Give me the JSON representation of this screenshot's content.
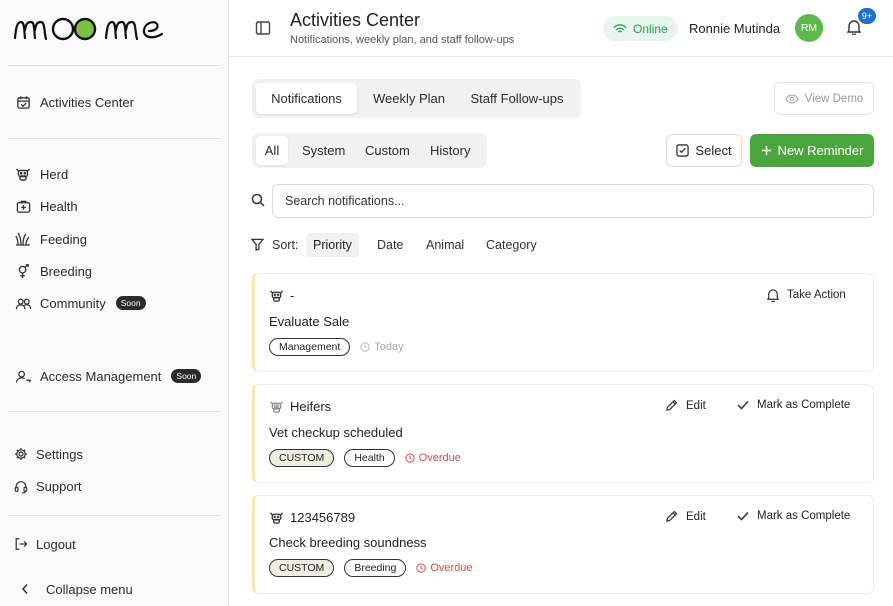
{
  "app": {
    "logo_text": "moome"
  },
  "sidebar": {
    "items": [
      {
        "label": "Activities Center",
        "icon": "calendar-check-icon"
      },
      {
        "label": "Herd",
        "icon": "cow-icon"
      },
      {
        "label": "Health",
        "icon": "medical-kit-icon"
      },
      {
        "label": "Feeding",
        "icon": "grass-icon"
      },
      {
        "label": "Breeding",
        "icon": "gender-icon"
      },
      {
        "label": "Community",
        "icon": "users-icon",
        "badge": "Soon"
      },
      {
        "label": "Access Management",
        "icon": "user-key-icon",
        "badge": "Soon"
      },
      {
        "label": "Settings",
        "icon": "gear-icon"
      },
      {
        "label": "Support",
        "icon": "headset-icon"
      },
      {
        "label": "Logout",
        "icon": "logout-icon"
      }
    ],
    "collapse_label": "Collapse menu"
  },
  "header": {
    "title": "Activities Center",
    "subtitle": "Notifications, weekly plan, and staff follow-ups",
    "status": "Online",
    "user_name": "Ronnie Mutinda",
    "avatar_initials": "RM",
    "notification_badge": "9+"
  },
  "tabs": [
    "Notifications",
    "Weekly Plan",
    "Staff Follow-ups"
  ],
  "view_demo_label": "View Demo",
  "filters": [
    "All",
    "System",
    "Custom",
    "History"
  ],
  "select_label": "Select",
  "new_reminder_label": "New Reminder",
  "search": {
    "placeholder": "Search notifications..."
  },
  "sort": {
    "label": "Sort:",
    "options": [
      "Priority",
      "Date",
      "Animal",
      "Category"
    ],
    "active": "Priority"
  },
  "notifications": [
    {
      "animal": "-",
      "title": "Evaluate Sale",
      "tags": [
        "Management"
      ],
      "when": "Today",
      "actions": [
        "Take Action"
      ]
    },
    {
      "animal": "Heifers",
      "title": "Vet checkup scheduled",
      "tags": [
        "CUSTOM",
        "Health"
      ],
      "when": "Overdue",
      "actions": [
        "Edit",
        "Mark as Complete"
      ]
    },
    {
      "animal": "123456789",
      "title": "Check breeding soundness",
      "tags": [
        "CUSTOM",
        "Breeding"
      ],
      "when": "Overdue",
      "actions": [
        "Edit",
        "Mark as Complete"
      ]
    }
  ],
  "colors": {
    "accent_green": "#4aa63c",
    "overdue_red": "#e04a3f",
    "badge_blue": "#1e72c9",
    "online_green": "#2f9e5a"
  }
}
